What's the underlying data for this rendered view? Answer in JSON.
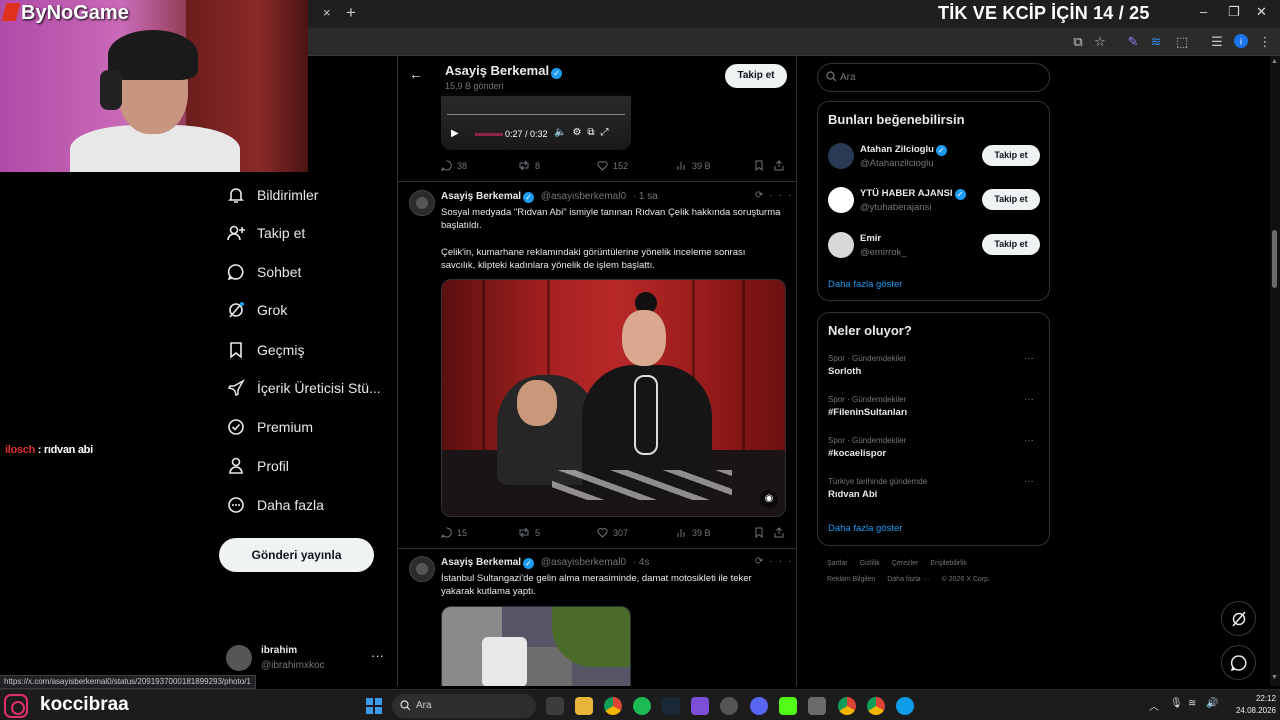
{
  "browser": {
    "overlay_title": "TİK VE KCİP İÇİN 14 / 25",
    "tab_close": "×",
    "tab_new": "+",
    "window_controls": [
      "–",
      "❐",
      "✕"
    ],
    "toolbar_icons": [
      "install-app-icon",
      "bookmark-star-icon",
      "extension-pen-icon",
      "extension-wave-icon",
      "extensions-icon",
      "reading-list-icon",
      "profile-icon",
      "menu-icon"
    ]
  },
  "overlay": {
    "brand": "ByNoGame",
    "chat": {
      "user": "ilosch",
      "separator": " : ",
      "message": "rıdvan abi"
    }
  },
  "nav": {
    "items": [
      {
        "label": "Bildirimler",
        "icon": "bell-icon"
      },
      {
        "label": "Takip et",
        "icon": "follow-icon"
      },
      {
        "label": "Sohbet",
        "icon": "chat-icon"
      },
      {
        "label": "Grok",
        "icon": "grok-icon"
      },
      {
        "label": "Geçmiş",
        "icon": "bookmark-icon"
      },
      {
        "label": "İçerik Üreticisi Stü...",
        "icon": "rocket-icon"
      },
      {
        "label": "Premium",
        "icon": "premium-icon"
      },
      {
        "label": "Profil",
        "icon": "profile-icon"
      },
      {
        "label": "Daha fazla",
        "icon": "more-icon"
      }
    ],
    "post_button": "Gönderi yayınla",
    "profile": {
      "name": "ibrahim",
      "handle": "@ibrahimxkoc",
      "more": "···"
    }
  },
  "timeline": {
    "header": {
      "back": "←",
      "name": "Asayiş Berkemal",
      "post_count": "15,9 B gönderi",
      "follow": "Takip et"
    },
    "video": {
      "time": "0:27 / 0:32"
    },
    "tweets": [
      {
        "stats": {
          "replies": "38",
          "reposts": "8",
          "likes": "152",
          "views": "39 B"
        }
      },
      {
        "name": "Asayiş Berkemal",
        "handle": "@asayisberkemal0",
        "time": "· 1 sa",
        "text1": "Sosyal medyada \"Rıdvan Abi\" ismiyle tanınan Rıdvan Çelik hakkında soruşturma başlatıldı.",
        "text2": "Çelik'in, kumarhane reklamındaki görüntülerine yönelik inceleme sonrası savcılık, klipteki kadınlara yönelik de işlem başlattı.",
        "stats": {
          "replies": "15",
          "reposts": "5",
          "likes": "307",
          "views": "39 B"
        }
      },
      {
        "name": "Asayiş Berkemal",
        "handle": "@asayisberkemal0",
        "time": "· 4s",
        "text1": "İstanbul Sultangazi'de gelin alma merasiminde, damat motosikleti ile teker yakarak kutlama yaptı."
      }
    ]
  },
  "right": {
    "search_placeholder": "Ara",
    "who_to_follow": {
      "title": "Bunları beğenebilirsin",
      "users": [
        {
          "name": "Atahan Zilcioglu",
          "handle": "@Atahanzilcioglu",
          "button": "Takip et"
        },
        {
          "name": "YTÜ HABER AJANSI",
          "handle": "@ytuhaberajansi",
          "button": "Takip et"
        },
        {
          "name": "Emir",
          "handle": "@emirrok_",
          "button": "Takip et"
        }
      ],
      "show_more": "Daha fazla göster"
    },
    "trends": {
      "title": "Neler oluyor?",
      "items": [
        {
          "meta": "Spor · Gündemdekiler",
          "name": "Sorloth"
        },
        {
          "meta": "Spor · Gündemdekiler",
          "name": "#FileninSultanları"
        },
        {
          "meta": "Spor · Gündemdekiler",
          "name": "#kocaelispor"
        },
        {
          "meta": "Türkiye tarihinde gündemde",
          "name": "Rıdvan Abi"
        }
      ],
      "more": "···",
      "show_more": "Daha fazla göster"
    },
    "footer": [
      "Şartlar",
      "Gizlilik",
      "Çerezler",
      "Erişilebilirlik",
      "Reklam Bilgileri",
      "Daha fazla ···",
      "© 2026 X Corp."
    ]
  },
  "status_url": "https://x.com/asayisberkemal0/status/2091937000181899293/photo/1",
  "taskbar": {
    "streamer": "koccibraa",
    "search_placeholder": "Ara",
    "time": "22:12",
    "date": "24.08.2026"
  },
  "colors": {
    "accent": "#1d9bf0",
    "background": "#000000",
    "text": "#e7e9ea",
    "muted": "#71767b",
    "chat_user": "#e0302a"
  }
}
